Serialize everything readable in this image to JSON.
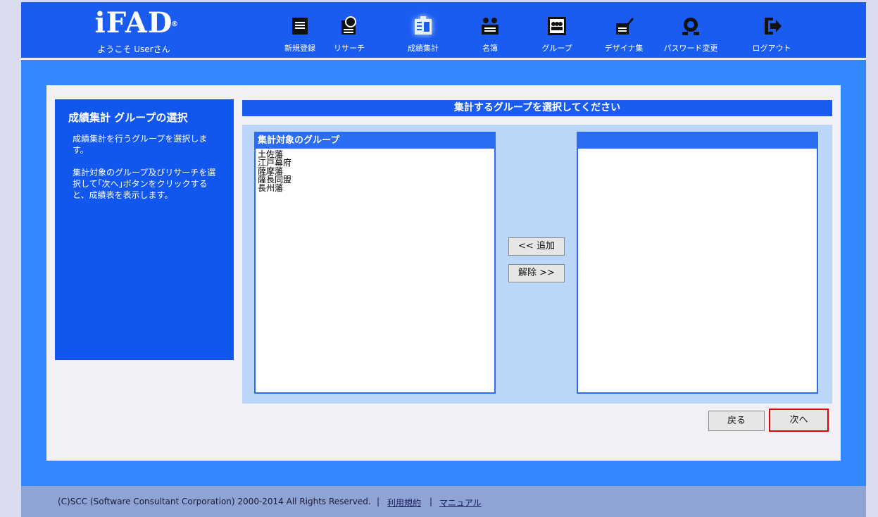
{
  "header": {
    "logo": "iFAD",
    "logo_mark": "®",
    "welcome": "ようこそ Userさん",
    "nav": [
      {
        "label": "新規登録",
        "icon": "document-icon"
      },
      {
        "label": "リサーチ",
        "icon": "research-icon"
      },
      {
        "label": "成績集計",
        "icon": "aggregate-icon"
      },
      {
        "label": "名簿",
        "icon": "members-icon"
      },
      {
        "label": "グループ",
        "icon": "group-icon"
      },
      {
        "label": "デザイナ集",
        "icon": "designer-icon"
      },
      {
        "label": "パスワード変更",
        "icon": "password-icon"
      },
      {
        "label": "ログアウト",
        "icon": "logout-icon"
      }
    ],
    "active_nav": "成績集計"
  },
  "sidebar": {
    "title": "成績集計 グループの選択",
    "desc1": "成績集計を行うグループを選択します。",
    "desc2": "集計対象のグループ及びリサーチを選択して｢次へ｣ボタンをクリックすると、成績表を表示します。"
  },
  "main": {
    "title": "集計するグループを選択してください",
    "left_list": {
      "header": "集計対象のグループ",
      "items": [
        "土佐藩",
        "江戸幕府",
        "薩摩藩",
        "薩長同盟",
        "長州藩"
      ]
    },
    "right_list": {
      "header": "",
      "items": []
    },
    "add_button": "<< 追加",
    "remove_button": "解除 >>",
    "back_button": "戻る",
    "next_button": "次へ"
  },
  "footer": {
    "copyright": "(C)SCC (Software Consultant Corporation) 2000-2014 All Rights Reserved.",
    "sep": "|",
    "terms": "利用規約",
    "manual": "マニュアル"
  },
  "colors": {
    "header_bg": "#1a5cf0",
    "content_bg": "#3388ff",
    "panel_bg": "#1157ee",
    "list_header": "#2a6cf2",
    "footer_bg": "#8fa4d4",
    "highlight_border": "#e0000a"
  }
}
